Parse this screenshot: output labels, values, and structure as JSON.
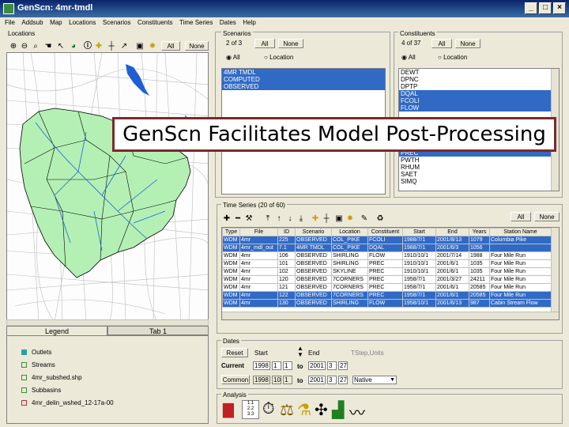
{
  "window": {
    "title": "GenScn: 4mr-tmdl"
  },
  "menu": [
    "File",
    "Addsub",
    "Map",
    "Locations",
    "Scenarios",
    "Constituents",
    "Time Series",
    "Dates",
    "Help"
  ],
  "locations": {
    "label": "Locations",
    "all": "All",
    "none": "None"
  },
  "scenarios": {
    "label": "Scenarios",
    "count": "2 of 3",
    "all": "All",
    "none": "None",
    "radio_all": "All",
    "radio_location": "Location",
    "items": [
      {
        "name": "4MR TMDL",
        "selected": false
      },
      {
        "name": "COMPUTED",
        "selected": false
      },
      {
        "name": "OBSERVED",
        "selected": true
      }
    ]
  },
  "constituents": {
    "label": "Constituents",
    "count": "4 of 37",
    "all": "All",
    "none": "None",
    "radio_all": "All",
    "radio_location": "Location",
    "items": [
      {
        "name": "DEWT",
        "selected": false
      },
      {
        "name": "DPNC",
        "selected": false
      },
      {
        "name": "DPTP",
        "selected": false
      },
      {
        "name": "DQAL",
        "selected": true
      },
      {
        "name": "FCOLI",
        "selected": true
      },
      {
        "name": "FLOW",
        "selected": true
      },
      {
        "name": "PREC",
        "selected": true
      },
      {
        "name": "PWTH",
        "selected": false
      },
      {
        "name": "RHUM",
        "selected": false
      },
      {
        "name": "SAET",
        "selected": false
      },
      {
        "name": "SIMQ",
        "selected": false
      }
    ]
  },
  "timeseries": {
    "label": "Time Series (20 of 60)",
    "all": "All",
    "none": "None",
    "columns": [
      "Type",
      "File",
      "ID",
      "Scenario",
      "Location",
      "Constituent",
      "Start",
      "End",
      "Years",
      "Station Name"
    ],
    "rows": [
      {
        "sel": true,
        "cells": [
          "WDM",
          "4mr",
          "225",
          "OBSERVED",
          "COL_PIKE",
          "FCOLI",
          "1988/7/1",
          "2001/8/13",
          "1079",
          "Columbia Pike"
        ]
      },
      {
        "sel": true,
        "cells": [
          "WDM",
          "4mr_mdl_out",
          "7.1",
          "4MR TMDL",
          "COL_PIKE",
          "DQAL",
          "1988/7/1",
          "2001/6/3",
          "1056",
          ""
        ]
      },
      {
        "sel": false,
        "cells": [
          "WDM",
          "4mr",
          "106",
          "OBSERVED",
          "SHIRLING",
          "FLOW",
          "1910/10/1",
          "2001/7/14",
          "1988",
          "Four Mile Run"
        ]
      },
      {
        "sel": false,
        "cells": [
          "WDM",
          "4mr",
          "101",
          "OBSERVED",
          "SHIRLING",
          "PREC",
          "1910/10/1",
          "2001/6/1",
          "1035",
          "Four Mile Run"
        ]
      },
      {
        "sel": false,
        "cells": [
          "WDM",
          "4mr",
          "102",
          "OBSERVED",
          "SKYLINE",
          "PREC",
          "1910/10/1",
          "2001/6/1",
          "1035",
          "Four Mile Run"
        ]
      },
      {
        "sel": false,
        "cells": [
          "WDM",
          "4mr",
          "120",
          "OBSERVED",
          "7CORNERS",
          "PREC",
          "1958/7/1",
          "2001/3/27",
          "24211",
          "Four Mile Run"
        ]
      },
      {
        "sel": false,
        "cells": [
          "WDM",
          "4mr",
          "121",
          "OBSERVED",
          "7CORNERS",
          "PREC",
          "1958/7/1",
          "2001/6/1",
          "20585",
          "Four Mile Run"
        ]
      },
      {
        "sel": true,
        "cells": [
          "WDM",
          "4mr",
          "122",
          "OBSERVED",
          "7CORNERS",
          "PREC",
          "1958/7/1",
          "2001/6/1",
          "20585",
          "Four Mile Run"
        ]
      },
      {
        "sel": true,
        "cells": [
          "WDM",
          "4mr",
          "130",
          "OBSERVED",
          "SHIRLING",
          "FLOW",
          "1958/10/1",
          "2001/6/13",
          "987",
          "Cabin Stream Flow"
        ]
      }
    ]
  },
  "legend": {
    "tab_legend": "Legend",
    "tab_1": "Tab 1",
    "items": [
      "Outlets",
      "Streams",
      "4mr_subshed.shp",
      "Subbasins",
      "4mr_delin_wshed_12-17a-00"
    ]
  },
  "dates": {
    "label": "Dates",
    "reset": "Reset",
    "start": "Start",
    "end": "End",
    "units": "TStep,Units",
    "current_label": "Current",
    "common_label": "Common",
    "current_start": [
      "1998",
      "1",
      "1"
    ],
    "current_end": [
      "2001",
      "3",
      "27"
    ],
    "common_start": [
      "1998",
      "10",
      "1"
    ],
    "common_end": [
      "2001",
      "3",
      "27"
    ],
    "to": "to",
    "native": "Native"
  },
  "analysis": {
    "label": "Analysis"
  },
  "banner": "GenScn Facilitates Model Post-Processing"
}
